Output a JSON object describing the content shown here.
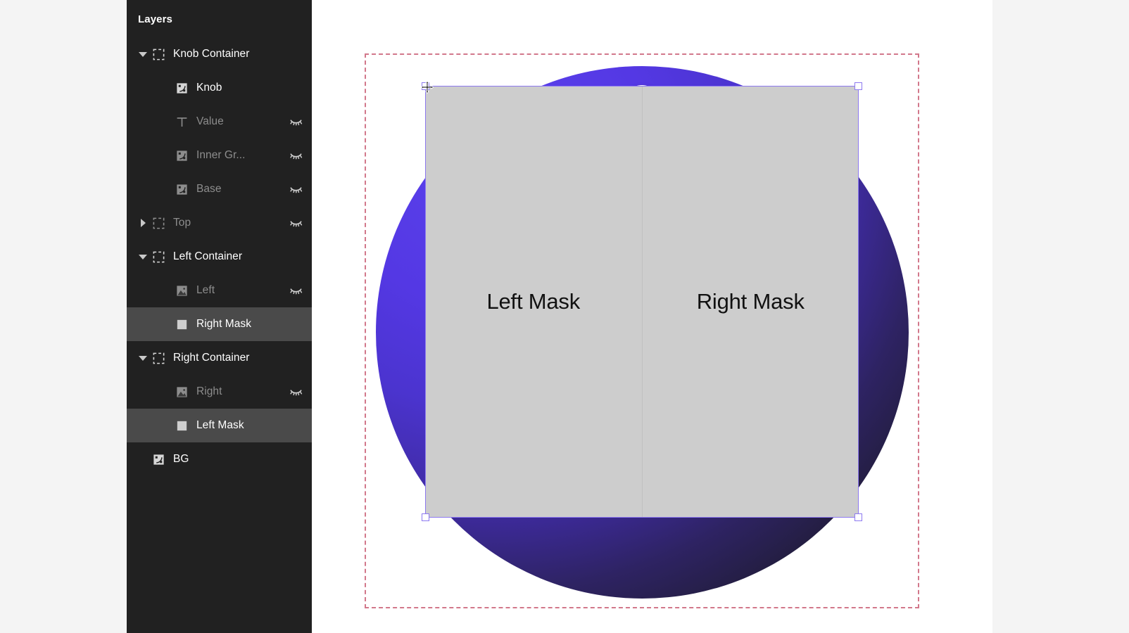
{
  "panel": {
    "title": "Layers",
    "layers": [
      {
        "name": "Knob Container",
        "icon": "frame-icon",
        "indent": 0,
        "caret": "down",
        "dim": false,
        "selected": false,
        "hidden": false
      },
      {
        "name": "Knob",
        "icon": "component-icon",
        "indent": 1,
        "caret": "none",
        "dim": false,
        "selected": false,
        "hidden": false
      },
      {
        "name": "Value",
        "icon": "text-icon",
        "indent": 1,
        "caret": "none",
        "dim": true,
        "selected": false,
        "hidden": true
      },
      {
        "name": "Inner Gr...",
        "icon": "component-icon",
        "indent": 1,
        "caret": "none",
        "dim": true,
        "selected": false,
        "hidden": true
      },
      {
        "name": "Base",
        "icon": "component-icon",
        "indent": 1,
        "caret": "none",
        "dim": true,
        "selected": false,
        "hidden": true
      },
      {
        "name": "Top",
        "icon": "frame-icon",
        "indent": 0,
        "caret": "right",
        "dim": true,
        "selected": false,
        "hidden": true
      },
      {
        "name": "Left Container",
        "icon": "frame-icon",
        "indent": 0,
        "caret": "down",
        "dim": false,
        "selected": false,
        "hidden": false
      },
      {
        "name": "Left",
        "icon": "image-icon",
        "indent": 1,
        "caret": "none",
        "dim": true,
        "selected": false,
        "hidden": true
      },
      {
        "name": "Right Mask",
        "icon": "rect-icon",
        "indent": 1,
        "caret": "none",
        "dim": false,
        "selected": true,
        "hidden": false
      },
      {
        "name": "Right Container",
        "icon": "frame-icon",
        "indent": 0,
        "caret": "down",
        "dim": false,
        "selected": false,
        "hidden": false
      },
      {
        "name": "Right",
        "icon": "image-icon",
        "indent": 1,
        "caret": "none",
        "dim": true,
        "selected": false,
        "hidden": true
      },
      {
        "name": "Left Mask",
        "icon": "rect-icon",
        "indent": 1,
        "caret": "none",
        "dim": false,
        "selected": true,
        "hidden": false
      },
      {
        "name": "BG",
        "icon": "component-icon",
        "indent": 0,
        "caret": "none",
        "dim": false,
        "selected": false,
        "hidden": false
      }
    ]
  },
  "canvas": {
    "left_mask_label": "Left Mask",
    "right_mask_label": "Right Mask",
    "colors": {
      "sphere_highlight": "#5B43EC",
      "sphere_mid": "#4B34CF",
      "sphere_shadow": "#191921",
      "mask_fill": "#CDCDCD",
      "selection": "#8D79F0",
      "frame_outline": "#C2455F",
      "knob": "#FFFFFF",
      "canvas_bg": "#FFFFFF",
      "app_bg": "#F4F4F4",
      "sidebar_bg": "#212121",
      "row_selected_bg": "#4A4A4A"
    }
  }
}
